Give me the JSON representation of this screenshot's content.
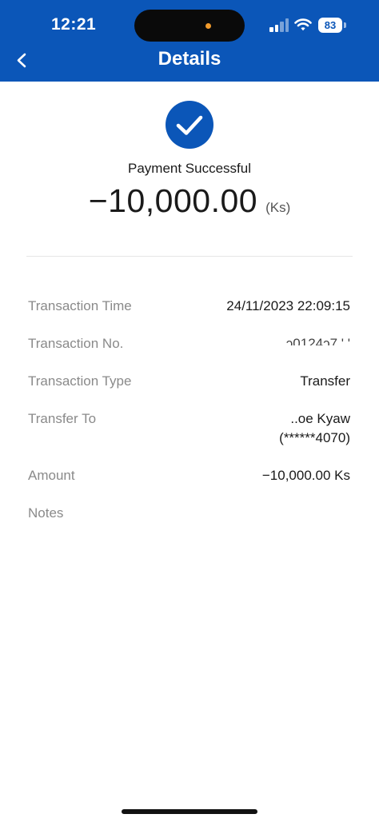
{
  "status_bar": {
    "time": "12:21",
    "battery": "83"
  },
  "header": {
    "title": "Details"
  },
  "summary": {
    "status": "Payment Successful",
    "amount": "−10,000.00",
    "currency": "(Ks)"
  },
  "details": {
    "time_label": "Transaction Time",
    "time_value": "24/11/2023 22:09:15",
    "no_label": "Transaction No.",
    "no_value": "ɔ0124ɔ7 ' '",
    "type_label": "Transaction Type",
    "type_value": "Transfer",
    "to_label": "Transfer To",
    "to_name": "..oe Kyaw",
    "to_account": "(******4070)",
    "amount_label": "Amount",
    "amount_value": "−10,000.00 Ks",
    "notes_label": "Notes"
  },
  "colors": {
    "brand": "#0b56b8",
    "label": "#8a8a8a",
    "text": "#1a1a1a"
  },
  "icons": [
    "back-chevron-icon",
    "check-circle-icon",
    "cellular-signal-icon",
    "wifi-icon",
    "battery-icon"
  ]
}
